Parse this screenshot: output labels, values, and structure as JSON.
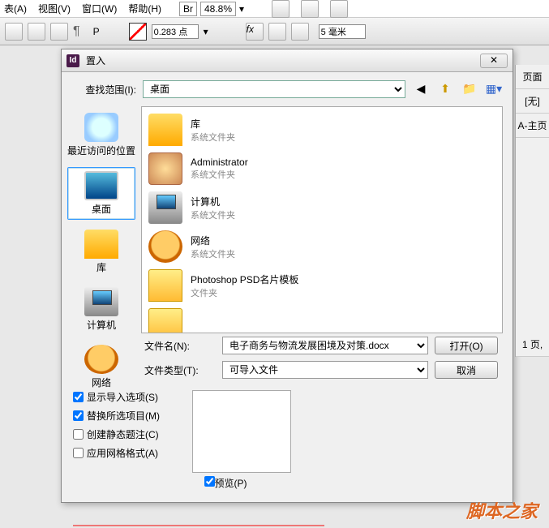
{
  "menu": {
    "table": "表(A)",
    "view": "视图(V)",
    "window": "窗口(W)",
    "help": "帮助(H)"
  },
  "zoom": {
    "br": "Br",
    "value": "48.8%"
  },
  "toolbar": {
    "pts_value": "0.283 点",
    "mm_value": "5 毫米"
  },
  "dialog": {
    "title": "置入",
    "lookin_label": "查找范围(I):",
    "lookin_value": "桌面",
    "icons": {
      "back": "back-icon",
      "up": "up-icon",
      "new": "new-folder-icon",
      "view": "view-menu-icon"
    }
  },
  "places": [
    {
      "name": "recent",
      "label": "最近访问的位置"
    },
    {
      "name": "desktop",
      "label": "桌面",
      "selected": true
    },
    {
      "name": "library",
      "label": "库"
    },
    {
      "name": "computer",
      "label": "计算机"
    },
    {
      "name": "network",
      "label": "网络"
    }
  ],
  "files": [
    {
      "name": "库",
      "type": "系统文件夹",
      "icon": "lib"
    },
    {
      "name": "Administrator",
      "type": "系统文件夹",
      "icon": "user"
    },
    {
      "name": "计算机",
      "type": "系统文件夹",
      "icon": "comp"
    },
    {
      "name": "网络",
      "type": "系统文件夹",
      "icon": "net"
    },
    {
      "name": "Photoshop PSD名片模板",
      "type": "文件夹",
      "icon": "folder"
    }
  ],
  "fields": {
    "filename_label": "文件名(N):",
    "filename_value": "电子商务与物流发展困境及对策.docx",
    "filetype_label": "文件类型(T):",
    "filetype_value": "可导入文件"
  },
  "buttons": {
    "open": "打开(O)",
    "cancel": "取消"
  },
  "checks": {
    "show_import": "显示导入选项(S)",
    "replace_sel": "替换所选项目(M)",
    "static_caption": "创建静态题注(C)",
    "apply_grid": "应用网格格式(A)",
    "preview": "预览(P)"
  },
  "rightpanel": {
    "pages": "页面",
    "none": "[无]",
    "master": "A-主页",
    "page1": "1 页,"
  },
  "watermark": "脚本之家"
}
